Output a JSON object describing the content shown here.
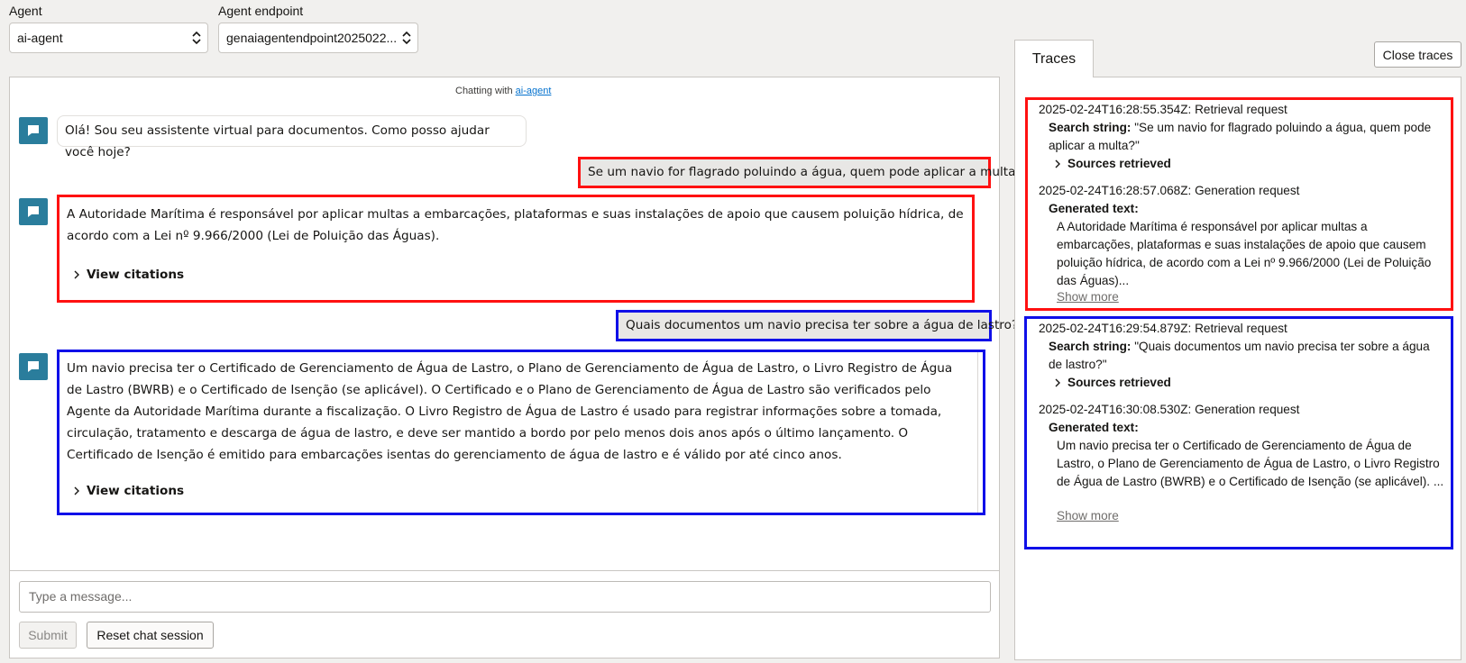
{
  "top": {
    "agent_label": "Agent",
    "agent_value": "ai-agent",
    "endpoint_label": "Agent endpoint",
    "endpoint_value": "genaiagentendpoint2025022..."
  },
  "chat": {
    "chatting_with_prefix": "Chatting with",
    "chatting_with_agent": "ai-agent",
    "messages": [
      {
        "role": "bot",
        "text": "Olá! Sou seu assistente virtual para documentos. Como posso ajudar você hoje?"
      },
      {
        "role": "user",
        "text": "Se um navio for flagrado poluindo a água, quem pode aplicar a multa?"
      },
      {
        "role": "bot",
        "text": "A Autoridade Marítima é responsável por aplicar multas a embarcações, plataformas e suas instalações de apoio que causem poluição hídrica, de acordo com a Lei nº 9.966/2000 (Lei de Poluição das Águas).",
        "citations": "View citations"
      },
      {
        "role": "user",
        "text": "Quais documentos um navio precisa ter sobre a água de lastro?"
      },
      {
        "role": "bot",
        "text": "Um navio precisa ter o Certificado de Gerenciamento de Água de Lastro, o Plano de Gerenciamento de Água de Lastro, o Livro Registro de Água de Lastro (BWRB) e o Certificado de Isenção (se aplicável). O Certificado e o Plano de Gerenciamento de Água de Lastro são verificados pelo Agente da Autoridade Marítima durante a fiscalização. O Livro Registro de Água de Lastro é usado para registrar informações sobre a tomada, circulação, tratamento e descarga de água de lastro, e deve ser mantido a bordo por pelo menos dois anos após o último lançamento. O Certificado de Isenção é emitido para embarcações isentas do gerenciamento de água de lastro e é válido por até cinco anos.",
        "citations": "View citations"
      }
    ],
    "input_placeholder": "Type a message...",
    "submit_label": "Submit",
    "reset_label": "Reset chat session"
  },
  "traces": {
    "tab_label": "Traces",
    "close_label": "Close traces",
    "groups": [
      {
        "retrieval_header": "2025-02-24T16:28:55.354Z: Retrieval request",
        "search_label": "Search string:",
        "search_value": "\"Se um navio for flagrado poluindo a água, quem pode aplicar a multa?\"",
        "sources_label": "Sources retrieved",
        "generation_header": "2025-02-24T16:28:57.068Z: Generation request",
        "generated_label": "Generated text:",
        "generated_value": "A Autoridade Marítima é responsável por aplicar multas a embarcações, plataformas e suas instalações de apoio que causem poluição hídrica, de acordo com a Lei nº 9.966/2000 (Lei de Poluição das Águas)...",
        "show_more": "Show more"
      },
      {
        "retrieval_header": "2025-02-24T16:29:54.879Z: Retrieval request",
        "search_label": "Search string:",
        "search_value": "\"Quais documentos um navio precisa ter sobre a água de lastro?\"",
        "sources_label": "Sources retrieved",
        "generation_header": "2025-02-24T16:30:08.530Z: Generation request",
        "generated_label": "Generated text:",
        "generated_value": "Um navio precisa ter o Certificado de Gerenciamento de Água de Lastro, o Plano de Gerenciamento de Água de Lastro, o Livro Registro de Água de Lastro (BWRB) e o Certificado de Isenção (se aplicável). ...",
        "show_more": "Show more"
      }
    ]
  },
  "colors": {
    "highlight_red": "#ff1111",
    "highlight_blue": "#1010e8",
    "avatar": "#2a7d9c"
  }
}
